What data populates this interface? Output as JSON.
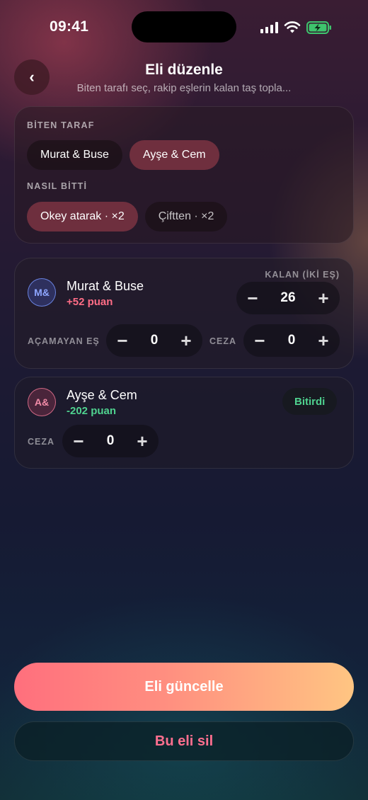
{
  "status_bar": {
    "time": "09:41"
  },
  "header": {
    "back_label": "‹",
    "title": "Eli düzenle",
    "subtitle": "Biten tarafı seç, rakip eşlerin kalan taş topla..."
  },
  "finishing_side": {
    "label": "BİTEN TARAF",
    "options": [
      {
        "label": "Murat & Buse",
        "selected": false
      },
      {
        "label": "Ayşe & Cem",
        "selected": true
      }
    ]
  },
  "finish_method": {
    "label": "NASIL BİTTİ",
    "options": [
      {
        "label": "Okey atarak · ×2",
        "selected": true
      },
      {
        "label": "Çiftten · ×2",
        "selected": false
      }
    ]
  },
  "teams": [
    {
      "initials": "M&",
      "name": "Murat & Buse",
      "points": "+52 puan",
      "remaining_label": "KALAN (İKİ EŞ)",
      "remaining_value": "26",
      "unopened_label": "AÇAMAYAN EŞ",
      "unopened_value": "0",
      "penalty_label": "CEZA",
      "penalty_value": "0"
    },
    {
      "initials": "A&",
      "name": "Ayşe & Cem",
      "points": "-202 puan",
      "badge": "Bitirdi",
      "penalty_label": "CEZA",
      "penalty_value": "0"
    }
  ],
  "stepper": {
    "minus": "−",
    "plus": "+"
  },
  "actions": {
    "update_label": "Eli güncelle",
    "delete_label": "Bu eli sil"
  },
  "colors": {
    "accent_red": "#ff6d86",
    "accent_green": "#4fd28f",
    "primary_gradient_start": "#ff6f7d",
    "primary_gradient_end": "#ffc582"
  }
}
